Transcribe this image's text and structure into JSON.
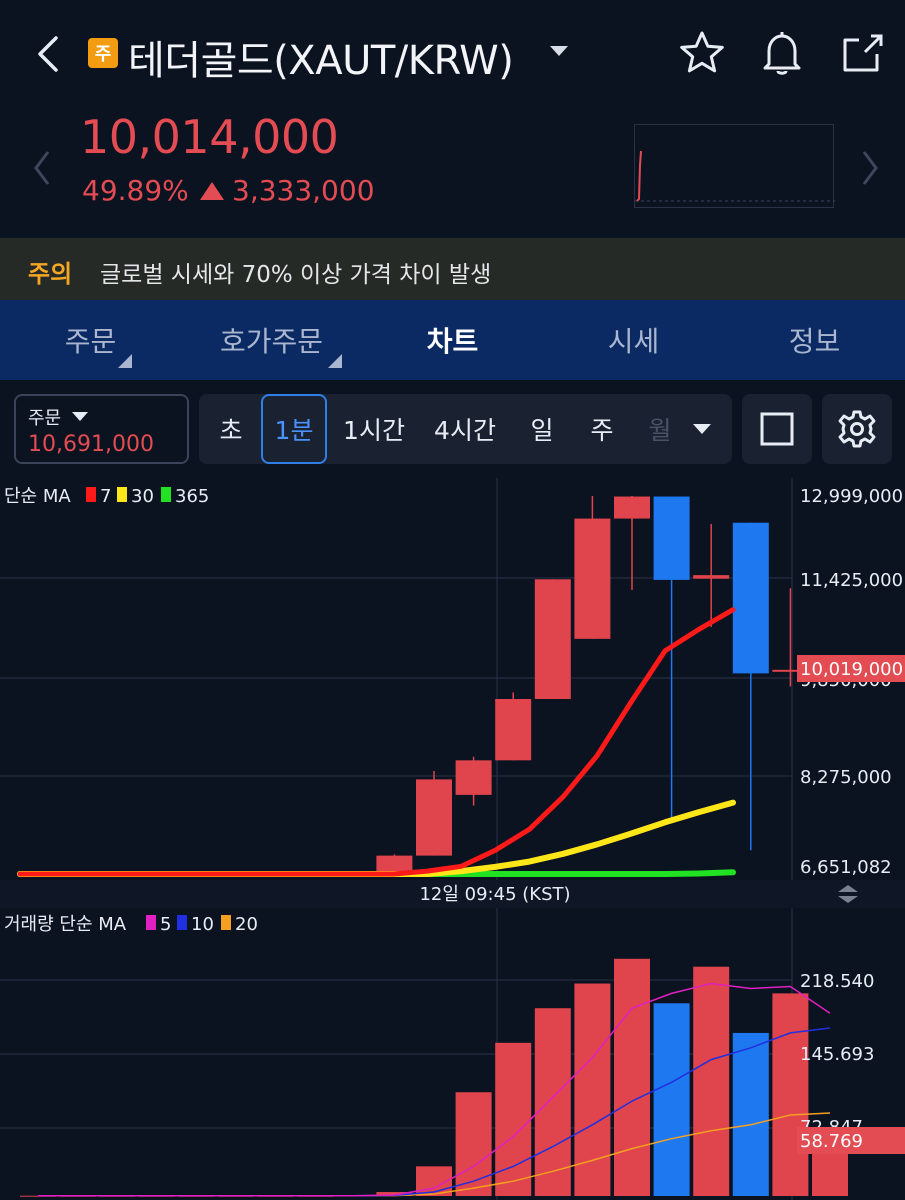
{
  "header": {
    "badge": "주",
    "title": "테더골드(XAUT/KRW)"
  },
  "price": {
    "current": "10,014,000",
    "change_pct": "49.89%",
    "change_amt": "3,333,000",
    "up_color": "#e24c52"
  },
  "warning": {
    "tag": "주의",
    "text": "글로벌 시세와 70% 이상 가격 차이 발생"
  },
  "tabs": [
    "주문",
    "호가주문",
    "차트",
    "시세",
    "정보"
  ],
  "active_tab": "차트",
  "order": {
    "label": "주문",
    "value": "10,691,000"
  },
  "intervals": [
    "초",
    "1분",
    "1시간",
    "4시간",
    "일",
    "주",
    "월"
  ],
  "selected_interval": "1분",
  "price_chart": {
    "legend_prefix": "단순 MA",
    "ma": [
      {
        "label": "7",
        "color": "#ff1a1a"
      },
      {
        "label": "30",
        "color": "#ffe619"
      },
      {
        "label": "365",
        "color": "#22e022"
      }
    ],
    "axis_labels": [
      "12,999,000",
      "11,425,000",
      "9,850,000",
      "8,275,000",
      "6,651,082"
    ],
    "current_tag": "10,019,000",
    "time_label": "12일 09:45 (KST)"
  },
  "volume_chart": {
    "legend_prefix": "거래량 단순 MA",
    "ma": [
      {
        "label": "5",
        "color": "#e020c0"
      },
      {
        "label": "10",
        "color": "#2030e0"
      },
      {
        "label": "20",
        "color": "#f5a020"
      }
    ],
    "axis_labels": [
      "218.540",
      "145.693",
      "72.847"
    ],
    "current_tag": "58.769"
  },
  "chart_data": {
    "type": "candlestick",
    "ylim": [
      6651082,
      12999000
    ],
    "up_color": "#e0444c",
    "down_color": "#1e78f0",
    "candles": [
      {
        "o": 6651082,
        "h": 6651082,
        "l": 6651082,
        "c": 6651082
      },
      {
        "o": 6651082,
        "h": 6651082,
        "l": 6651082,
        "c": 6651082
      },
      {
        "o": 6651082,
        "h": 6651082,
        "l": 6651082,
        "c": 6651082
      },
      {
        "o": 6651082,
        "h": 6651082,
        "l": 6651082,
        "c": 6651082
      },
      {
        "o": 6651082,
        "h": 6651082,
        "l": 6651082,
        "c": 6651082
      },
      {
        "o": 6651082,
        "h": 6651082,
        "l": 6651082,
        "c": 6651082
      },
      {
        "o": 6651082,
        "h": 6651082,
        "l": 6651082,
        "c": 6651082
      },
      {
        "o": 6651082,
        "h": 6651082,
        "l": 6651082,
        "c": 6651082
      },
      {
        "o": 6651082,
        "h": 6700000,
        "l": 6651082,
        "c": 6680000
      },
      {
        "o": 6680000,
        "h": 6980000,
        "l": 6680000,
        "c": 6960000
      },
      {
        "o": 6960000,
        "h": 8380000,
        "l": 6960000,
        "c": 8240000
      },
      {
        "o": 7980000,
        "h": 8620000,
        "l": 7800000,
        "c": 8560000
      },
      {
        "o": 8560000,
        "h": 9700000,
        "l": 8560000,
        "c": 9590000
      },
      {
        "o": 9590000,
        "h": 11600000,
        "l": 9590000,
        "c": 11600000
      },
      {
        "o": 10600000,
        "h": 12999000,
        "l": 10600000,
        "c": 12620000
      },
      {
        "o": 12620000,
        "h": 12999000,
        "l": 11420000,
        "c": 12990000
      },
      {
        "o": 12990000,
        "h": 12830000,
        "l": 7500000,
        "c": 11590000
      },
      {
        "o": 11610000,
        "h": 12530000,
        "l": 10800000,
        "c": 11670000
      },
      {
        "o": 12550000,
        "h": 12550000,
        "l": 7050000,
        "c": 10020000
      },
      {
        "o": 10080000,
        "h": 11450000,
        "l": 9800000,
        "c": 10080000
      }
    ],
    "ma7": [
      6651082,
      6651082,
      6651082,
      6651082,
      6651082,
      6651082,
      6651082,
      6651082,
      6651082,
      6651082,
      6651082,
      6651082,
      6700000,
      6780000,
      7050000,
      7400000,
      7950000,
      8640000,
      9540000,
      10400000,
      10760000,
      11090000
    ],
    "ma30": [
      6651082,
      6651082,
      6651082,
      6651082,
      6651082,
      6651082,
      6651082,
      6651082,
      6651082,
      6651082,
      6651082,
      6651082,
      6651082,
      6700000,
      6770000,
      6860000,
      6990000,
      7150000,
      7330000,
      7520000,
      7690000,
      7850000
    ],
    "ma365": [
      6651082,
      6651082,
      6651082,
      6651082,
      6651082,
      6651082,
      6651082,
      6651082,
      6651082,
      6651082,
      6651082,
      6651082,
      6651082,
      6651082,
      6651082,
      6651082,
      6651082,
      6651082,
      6651082,
      6651082,
      6660000,
      6680000
    ],
    "volume": [
      0.3,
      0.3,
      0.3,
      0.3,
      0.3,
      0.3,
      0.3,
      0.3,
      0.5,
      4,
      30,
      105,
      155,
      190,
      215,
      240,
      195,
      232,
      165,
      205,
      58.769
    ],
    "volume_up": [
      true,
      true,
      true,
      true,
      true,
      true,
      true,
      true,
      true,
      true,
      true,
      true,
      true,
      true,
      true,
      true,
      false,
      true,
      false,
      true,
      true
    ],
    "vol_ma5": [
      0.3,
      0.3,
      0.3,
      0.3,
      0.3,
      0.3,
      0.3,
      0.3,
      0.3,
      1,
      8,
      30,
      60,
      100,
      140,
      190,
      205,
      215,
      210,
      212,
      185
    ],
    "vol_ma10": [
      0.3,
      0.3,
      0.3,
      0.3,
      0.3,
      0.3,
      0.3,
      0.3,
      0.3,
      0.6,
      4,
      15,
      30,
      50,
      72,
      96,
      115,
      138,
      150,
      165,
      170
    ],
    "vol_ma20": [
      0.3,
      0.3,
      0.3,
      0.3,
      0.3,
      0.3,
      0.3,
      0.3,
      0.3,
      0.4,
      2,
      8,
      15,
      25,
      36,
      48,
      58,
      66,
      72,
      82,
      84
    ],
    "vol_ylim": [
      0,
      291.4
    ]
  }
}
